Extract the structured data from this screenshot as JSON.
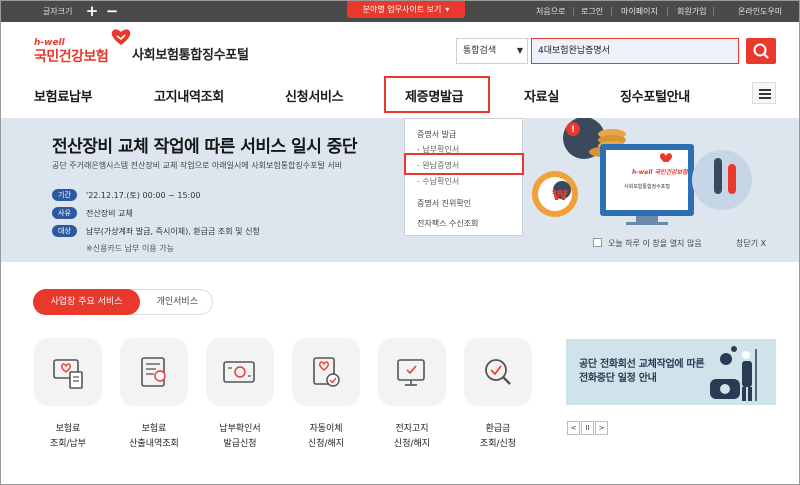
{
  "topbar": {
    "font_size_label": "글자크기",
    "plus": "+",
    "minus": "−",
    "site_button": "분야별 업무사이트 보기",
    "links": [
      "처음으로",
      "로그인",
      "마이페이지",
      "회원가입",
      "온라인도우미"
    ]
  },
  "header": {
    "logo_small": "h-well",
    "logo_name": "국민건강보험",
    "portal_title": "사회보험통합징수포털",
    "search_select": "통합검색",
    "search_value": "4대보험완납증명서"
  },
  "nav": {
    "items": [
      "보험료납부",
      "고지내역조회",
      "신청서비스",
      "제증명발급",
      "자료실",
      "징수포털안내"
    ],
    "active_index": 3
  },
  "dropdown": {
    "group1": "증명서 발급",
    "sub1": "- 납부확인서",
    "sub2": "- 완납증명서",
    "sub3": "- 수납확인서",
    "group2": "증명서 진위확인",
    "group3": "전자팩스 수신조회"
  },
  "banner": {
    "title": "전산장비 교체 작업에 따른 서비스 일시 중단",
    "subtitle": "공단 주거래은행시스템 전산장비 교체 작업으로 아래일시에 사회보험통합징수포털 서비",
    "rows": [
      {
        "tag": "기간",
        "value": "'22.12.17.(토) 00:00 ~ 15:00"
      },
      {
        "tag": "사유",
        "value": "전산장비 교체"
      },
      {
        "tag": "대상",
        "value": "납부(가상계좌 발급, 즉시이체), 환급금 조회 및 신청"
      }
    ],
    "note": "※신용카드 납부 이용 가능",
    "today_label": "오늘 하루 이 창을 열지 않음",
    "close_label": "창닫기 X",
    "monitor_logo": "h-well 국민건강보험",
    "monitor_text": "사회보험통합징수포털"
  },
  "tabs": {
    "active": "사업장 주요 서비스",
    "inactive": "개인서비스"
  },
  "services": [
    {
      "line1": "보험료",
      "line2": "조회/납부"
    },
    {
      "line1": "보험료",
      "line2": "산출내역조회"
    },
    {
      "line1": "납부확인서",
      "line2": "발급신청"
    },
    {
      "line1": "자동이체",
      "line2": "신청/해지"
    },
    {
      "line1": "전자고지",
      "line2": "신청/해지"
    },
    {
      "line1": "환급금",
      "line2": "조회/신청"
    }
  ],
  "side_banner": {
    "line1": "공단 전화회선 교체작업에 따른",
    "line2": "전화중단 일정 안내",
    "prev": "<",
    "pause": "II",
    "next": ">"
  },
  "colors": {
    "accent": "#e8392c",
    "banner_bg": "#dde6ef",
    "pill": "#2c5aa0",
    "topbar": "#4a4a4a"
  }
}
